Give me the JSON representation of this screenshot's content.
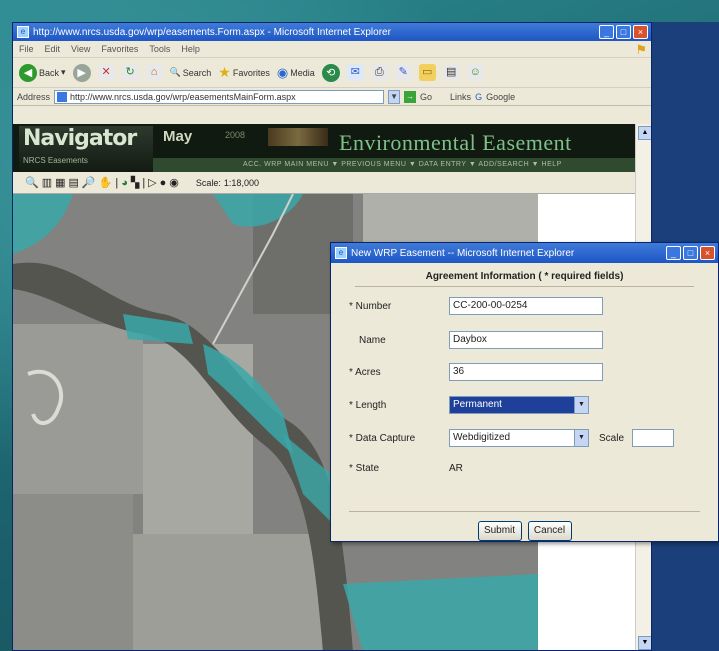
{
  "main_window": {
    "title": "http://www.nrcs.usda.gov/wrp/easements.Form.aspx - Microsoft Internet Explorer",
    "menu": [
      "File",
      "Edit",
      "View",
      "Favorites",
      "Tools",
      "Help"
    ],
    "toolbar": {
      "back": "Back",
      "search": "Search",
      "favorites": "Favorites",
      "media": "Media"
    },
    "address_label": "Address",
    "address_value": "http://www.nrcs.usda.gov/wrp/easementsMainForm.aspx",
    "go_label": "Go",
    "links_label": "Links",
    "google_label": "Google"
  },
  "banner": {
    "logo": "Navigator",
    "logo_sub": "NRCS Easements",
    "month": "May",
    "month_sub": "2008",
    "title": "Environmental Easement",
    "nav_text": "ACC. WRP MAIN MENU  ▼  PREVIOUS MENU  ▼  DATA ENTRY  ▼  ADD/SEARCH  ▼  HELP"
  },
  "map_toolbar": {
    "scale_label": "Scale:",
    "scale_value": "1:18,000"
  },
  "dialog": {
    "title": "New WRP Easement -- Microsoft Internet Explorer",
    "heading": "Agreement Information ( * required fields)",
    "fields": {
      "number": {
        "label": "* Number",
        "value": "CC-200-00-0254"
      },
      "name": {
        "label": "Name",
        "value": "Daybox"
      },
      "acres": {
        "label": "* Acres",
        "value": "36"
      },
      "length": {
        "label": "* Length",
        "value": "Permanent"
      },
      "data_capture": {
        "label": "* Data Capture",
        "value": "Webdigitized"
      },
      "scale": {
        "label": "Scale",
        "value": ""
      },
      "state": {
        "label": "* State",
        "value": "AR"
      }
    },
    "submit_label": "Submit",
    "cancel_label": "Cancel"
  },
  "colors": {
    "easement_fill": "#3aa8a8",
    "title_bar": "#1e56c4",
    "page_background": "#2c8a90"
  }
}
